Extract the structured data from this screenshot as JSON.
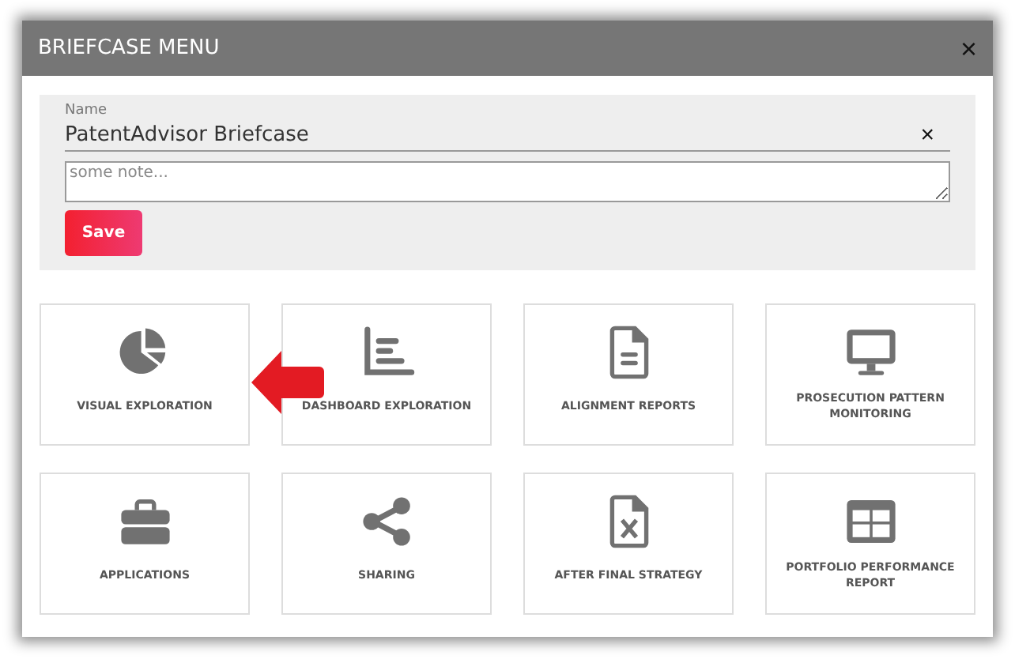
{
  "dialog": {
    "title": "BRIEFCASE MENU",
    "close": "×"
  },
  "form": {
    "name_label": "Name",
    "name_value": "PatentAdvisor Briefcase",
    "clear": "×",
    "note_placeholder": "some note...",
    "save": "Save"
  },
  "tiles": [
    {
      "label": "VISUAL EXPLORATION"
    },
    {
      "label": "DASHBOARD EXPLORATION"
    },
    {
      "label": "ALIGNMENT REPORTS"
    },
    {
      "label": "PROSECUTION PATTERN MONITORING"
    },
    {
      "label": "APPLICATIONS"
    },
    {
      "label": "SHARING"
    },
    {
      "label": "AFTER FINAL STRATEGY"
    },
    {
      "label": "PORTFOLIO PERFORMANCE REPORT"
    }
  ]
}
